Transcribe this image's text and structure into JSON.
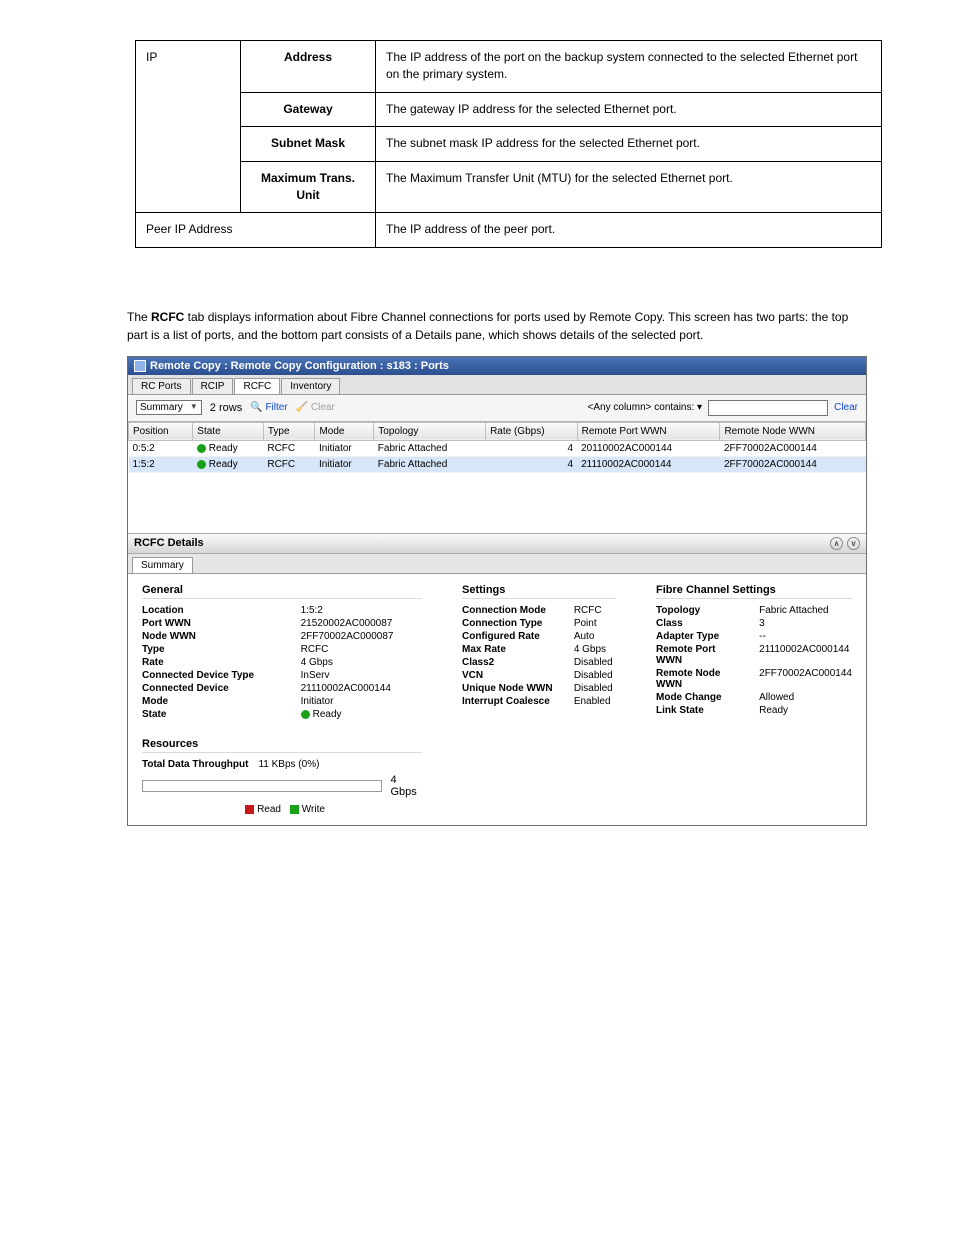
{
  "ref_table": {
    "group": "IP",
    "rows": [
      {
        "label": "Address",
        "desc": "The IP address of the port on the backup system connected to the selected Ethernet port on the primary system."
      },
      {
        "label": "Gateway",
        "desc": "The gateway IP address for the selected Ethernet port."
      },
      {
        "label": "Subnet Mask",
        "desc": "The subnet mask IP address for the selected Ethernet port."
      },
      {
        "label": "Maximum Trans. Unit",
        "desc": "The Maximum Transfer Unit (MTU) for the selected Ethernet port."
      }
    ],
    "last_row": {
      "col1": "Peer IP Address",
      "desc": "The IP address of the peer port."
    }
  },
  "intro": {
    "before_bold": "The ",
    "bold": "RCFC",
    "after_bold": " tab displays information about Fibre Channel connections for ports used by Remote Copy. This screen has two parts: the top part is a list of ports, and the bottom part consists of a Details pane, which shows details of the selected port."
  },
  "window": {
    "title": "Remote Copy : Remote Copy Configuration : s183 : Ports",
    "tabs": [
      "RC Ports",
      "RCIP",
      "RCFC",
      "Inventory"
    ],
    "active_tab": 2,
    "view_selector": "Summary",
    "row_count": "2 rows",
    "filter_label": "Filter",
    "clear_label_toolbar": "Clear",
    "filter_combo": "<Any column> contains:",
    "clear_link": "Clear",
    "columns": [
      "Position",
      "State",
      "Type",
      "Mode",
      "Topology",
      "Rate (Gbps)",
      "Remote Port WWN",
      "Remote Node WWN"
    ],
    "rows": [
      {
        "pos": "0:5:2",
        "state": "Ready",
        "type": "RCFC",
        "mode": "Initiator",
        "topology": "Fabric Attached",
        "rate": "4",
        "rport": "20110002AC000144",
        "rnode": "2FF70002AC000144",
        "sel": false
      },
      {
        "pos": "1:5:2",
        "state": "Ready",
        "type": "RCFC",
        "mode": "Initiator",
        "topology": "Fabric Attached",
        "rate": "4",
        "rport": "21110002AC000144",
        "rnode": "2FF70002AC000144",
        "sel": true
      }
    ],
    "details_title": "RCFC Details",
    "details_tabs": [
      "Summary"
    ],
    "general": {
      "title": "General",
      "items": [
        {
          "k": "Location",
          "v": "1:5:2"
        },
        {
          "k": "Port WWN",
          "v": "21520002AC000087"
        },
        {
          "k": "Node WWN",
          "v": "2FF70002AC000087"
        },
        {
          "k": "Type",
          "v": "RCFC"
        },
        {
          "k": "Rate",
          "v": "4 Gbps"
        },
        {
          "k": "Connected Device Type",
          "v": "InServ"
        },
        {
          "k": "Connected Device",
          "v": "21110002AC000144"
        },
        {
          "k": "Mode",
          "v": "Initiator"
        },
        {
          "k": "State",
          "v": "Ready",
          "dot": true
        }
      ]
    },
    "settings": {
      "title": "Settings",
      "items": [
        {
          "k": "Connection Mode",
          "v": "RCFC"
        },
        {
          "k": "Connection Type",
          "v": "Point"
        },
        {
          "k": "Configured Rate",
          "v": "Auto"
        },
        {
          "k": "Max Rate",
          "v": "4 Gbps"
        },
        {
          "k": "Class2",
          "v": "Disabled"
        },
        {
          "k": "VCN",
          "v": "Disabled"
        },
        {
          "k": "Unique Node WWN",
          "v": "Disabled"
        },
        {
          "k": "Interrupt Coalesce",
          "v": "Enabled"
        }
      ]
    },
    "fc": {
      "title": "Fibre Channel Settings",
      "items": [
        {
          "k": "Topology",
          "v": "Fabric Attached"
        },
        {
          "k": "Class",
          "v": "3"
        },
        {
          "k": "Adapter Type",
          "v": "--"
        },
        {
          "k": "Remote Port WWN",
          "v": "21110002AC000144"
        },
        {
          "k": "Remote Node WWN",
          "v": "2FF70002AC000144"
        },
        {
          "k": "Mode Change",
          "v": "Allowed"
        },
        {
          "k": "Link State",
          "v": "Ready"
        }
      ]
    },
    "resources": {
      "title": "Resources",
      "throughput_label": "Total Data Throughput",
      "throughput_value": "11 KBps (0%)",
      "bar_max": "4 Gbps",
      "legend_read": "Read",
      "legend_write": "Write"
    }
  }
}
